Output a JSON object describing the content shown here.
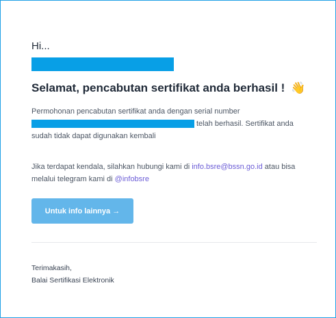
{
  "email": {
    "greeting": "Hi...",
    "headline": "Selamat, pencabutan sertifikat anda berhasil !",
    "headline_emoji": "👋",
    "paragraph1_line1": "Permohonan pencabutan sertifikat anda dengan serial number",
    "paragraph1_line2_tail": "telah berhasil. Sertifikat anda",
    "paragraph1_line3": "sudah tidak dapat digunakan kembali",
    "paragraph2_line1_prefix": "Jika terdapat kendala, silahkan hubungi kami di ",
    "paragraph2_email_link": "info.bsre@bssn.go.id",
    "paragraph2_line1_suffix": " atau bisa",
    "paragraph2_line2_prefix": "melalui telegram kami di ",
    "paragraph2_telegram_link": "@infobsre",
    "cta_button": "Untuk info lainnya →",
    "signoff": "Terimakasih,",
    "signature": "Balai Sertifikasi Elektronik"
  },
  "colors": {
    "frame_border": "#1ea0e6",
    "redaction": "#089fe6",
    "button": "#63b6ea",
    "link": "#6b5cd6"
  }
}
